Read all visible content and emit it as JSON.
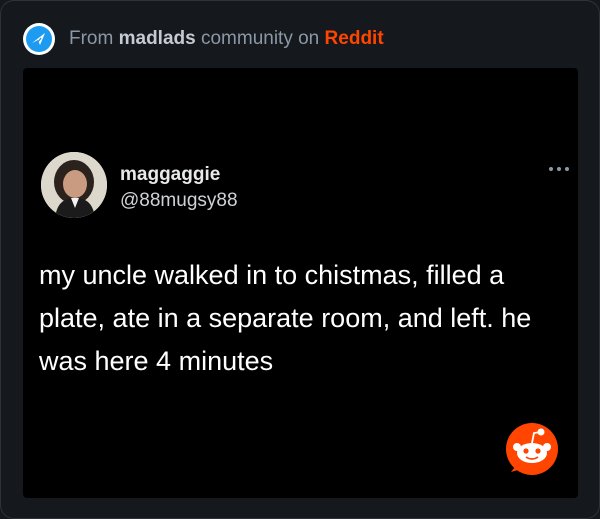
{
  "header": {
    "prefix": "From",
    "community": "madlads",
    "middle": "community on",
    "platform": "Reddit"
  },
  "tweet": {
    "display_name": "maggaggie",
    "handle": "@88mugsy88",
    "text": "my uncle walked in to chistmas, filled a plate, ate in a separate room, and left. he was here 4 minutes"
  },
  "icons": {
    "source_badge": "paper-plane-badge-icon",
    "more": "more-options-icon",
    "reddit": "reddit-snoo-icon"
  },
  "colors": {
    "background": "#15181c",
    "accent_blue": "#1d9bf0",
    "reddit_orange": "#ff4500",
    "muted_text": "#8b98a5"
  }
}
